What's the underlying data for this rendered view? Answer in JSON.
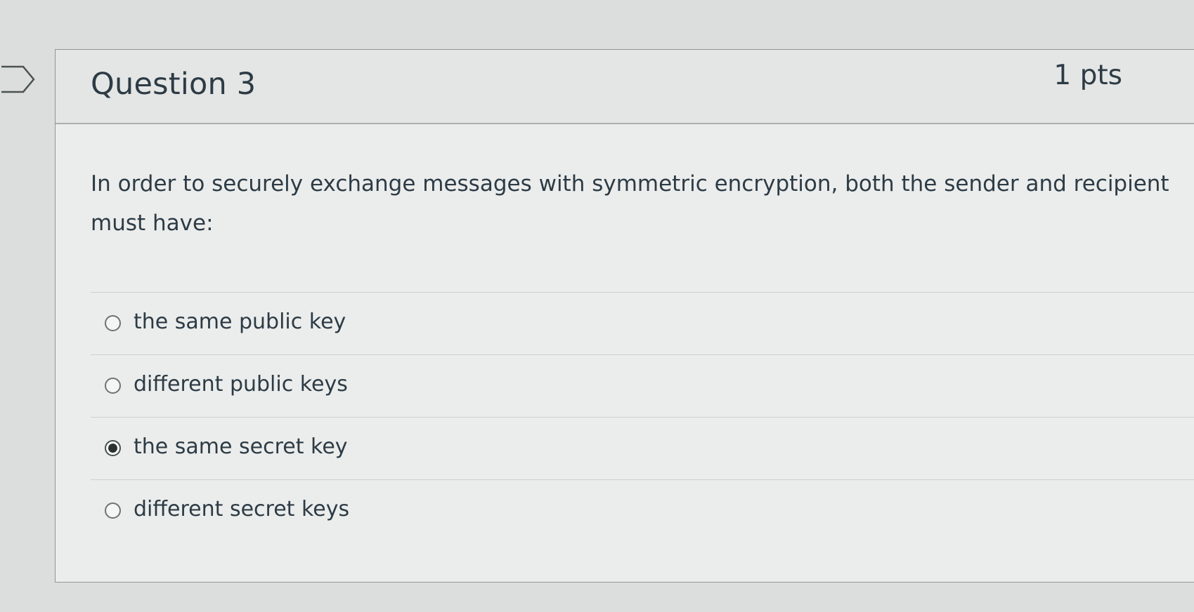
{
  "question": {
    "title": "Question 3",
    "points": "1 pts",
    "text": "In order to securely exchange messages with symmetric encryption, both the sender and recipient must have:",
    "answers": [
      {
        "label": "the same public key",
        "selected": false
      },
      {
        "label": "different public keys",
        "selected": false
      },
      {
        "label": "the same secret key",
        "selected": true
      },
      {
        "label": "different secret keys",
        "selected": false
      }
    ]
  },
  "icons": {
    "flag": "flag-outline-icon"
  },
  "colors": {
    "background": "#dcdedd",
    "card": "#ebedec",
    "text": "#2d3b45"
  }
}
